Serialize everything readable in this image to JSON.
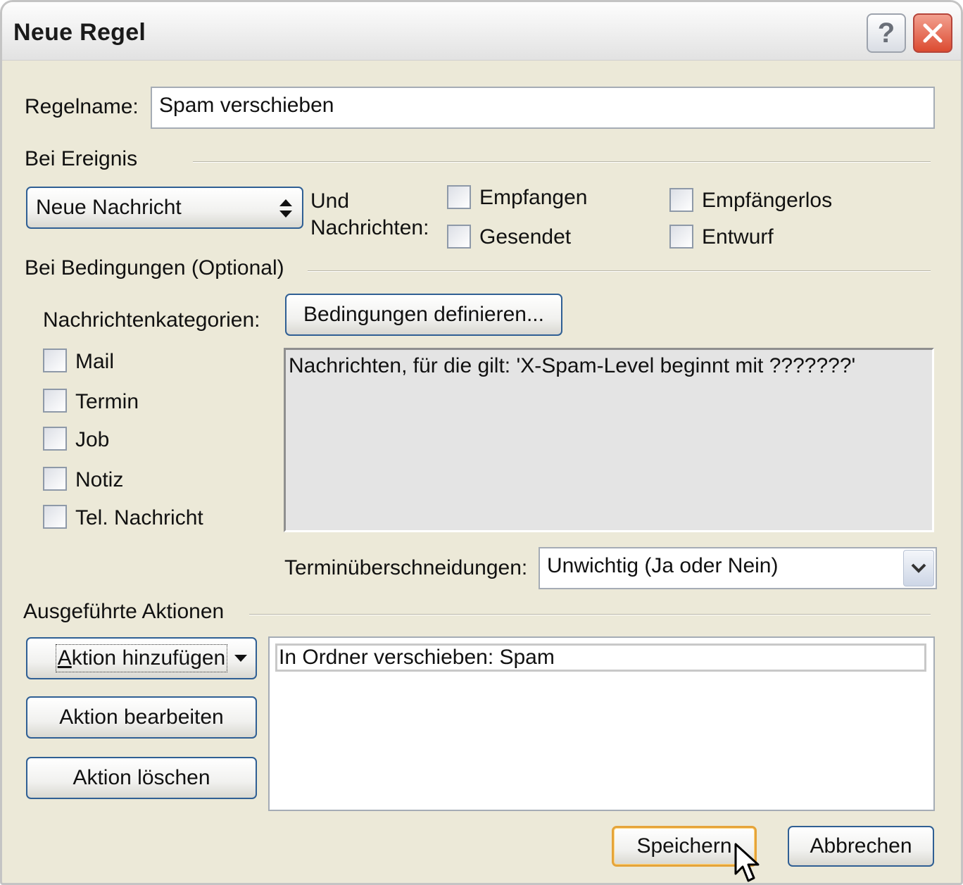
{
  "window": {
    "title": "Neue Regel",
    "help_label": "?",
    "accent_color": "#2f5f94",
    "close_color": "#dc4b31"
  },
  "rule_name": {
    "label": "Regelname:",
    "value": "Spam verschieben"
  },
  "event_section": {
    "heading": "Bei Ereignis",
    "event_select": {
      "selected": "Neue Nachricht",
      "icon": "updown-arrows-icon"
    },
    "und_label": "Und",
    "nachrichten_label": "Nachrichten:",
    "checkboxes": [
      {
        "label": "Empfangen",
        "checked": false
      },
      {
        "label": "Gesendet",
        "checked": false
      },
      {
        "label": "Empfängerlos",
        "checked": false
      },
      {
        "label": "Entwurf",
        "checked": false
      }
    ]
  },
  "conditions_section": {
    "heading": "Bei Bedingungen",
    "heading_optional": "(Optional)",
    "categories_label": "Nachrichtenkategorien:",
    "define_button": "Bedingungen definieren...",
    "categories": [
      {
        "label": "Mail",
        "checked": false
      },
      {
        "label": "Termin",
        "checked": false
      },
      {
        "label": "Job",
        "checked": false
      },
      {
        "label": "Notiz",
        "checked": false
      },
      {
        "label": "Tel. Nachricht",
        "checked": false
      }
    ],
    "conditions_text": "Nachrichten, für die gilt: 'X-Spam-Level  beginnt mit ???????'",
    "overlap_label": "Terminüberschneidungen:",
    "overlap_value": "Unwichtig (Ja oder Nein)",
    "overlap_icon": "chevron-down-icon"
  },
  "actions_section": {
    "heading": "Ausgeführte Aktionen",
    "add_action_mnemonic": "A",
    "add_action_rest": "ktion hinzufügen",
    "edit_action": "Aktion bearbeiten",
    "delete_action": "Aktion löschen",
    "actions": [
      "In Ordner verschieben: Spam"
    ]
  },
  "footer": {
    "save_button": "Speichern",
    "cancel_button": "Abbrechen"
  }
}
